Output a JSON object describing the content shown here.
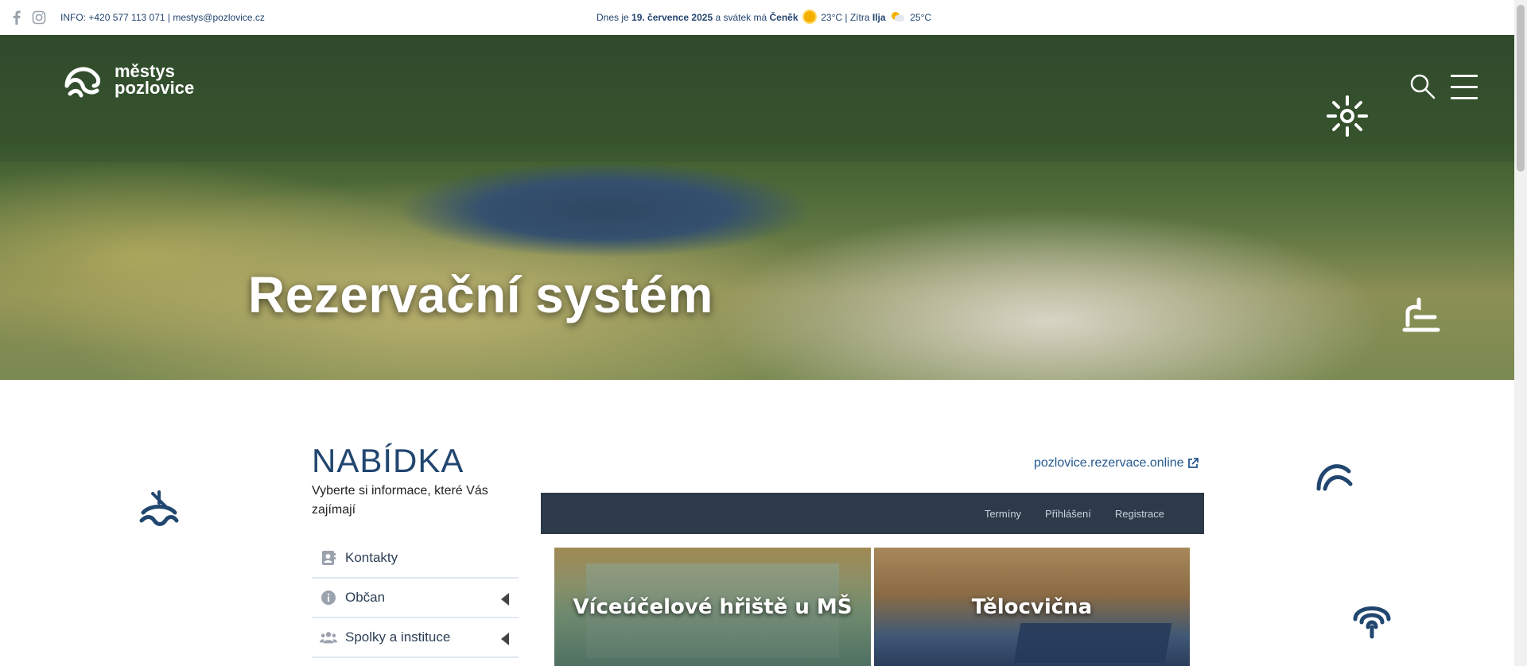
{
  "topbar": {
    "info": "INFO: +420 577 113 071 | mestys@pozlovice.cz",
    "today_prefix": "Dnes je",
    "date": "19. července 2025",
    "nameday_prefix": "a svátek má",
    "nameday": "Čeněk",
    "temp_today": "23°C",
    "tomorrow_prefix": "| Zítra",
    "tomorrow_name": "Ilja",
    "temp_tomorrow": "25°C",
    "icons": [
      "facebook-icon",
      "instagram-icon",
      "sun-icon",
      "partly-cloudy-icon"
    ]
  },
  "header": {
    "logo_line1": "městys",
    "logo_line2": "pozlovice"
  },
  "hero": {
    "title": "Rezervační systém"
  },
  "menu": {
    "heading": "NABÍDKA",
    "subtitle": "Vyberte si informace, které Vás zajímají",
    "items": [
      {
        "label": "Kontakty",
        "icon": "contact-card-icon"
      },
      {
        "label": "Občan",
        "icon": "info-icon"
      },
      {
        "label": "Spolky a instituce",
        "icon": "users-icon"
      }
    ]
  },
  "reservation": {
    "external_link": "pozlovice.rezervace.online",
    "nav": [
      "Termíny",
      "Přihlášení",
      "Registrace"
    ],
    "cards": [
      {
        "label": "Víceúčelové hřiště u MŠ"
      },
      {
        "label": "Tělocvična"
      }
    ]
  },
  "colors": {
    "brand_blue": "#21466f",
    "bar_dark": "#2c3a4a",
    "link": "#24588f"
  }
}
